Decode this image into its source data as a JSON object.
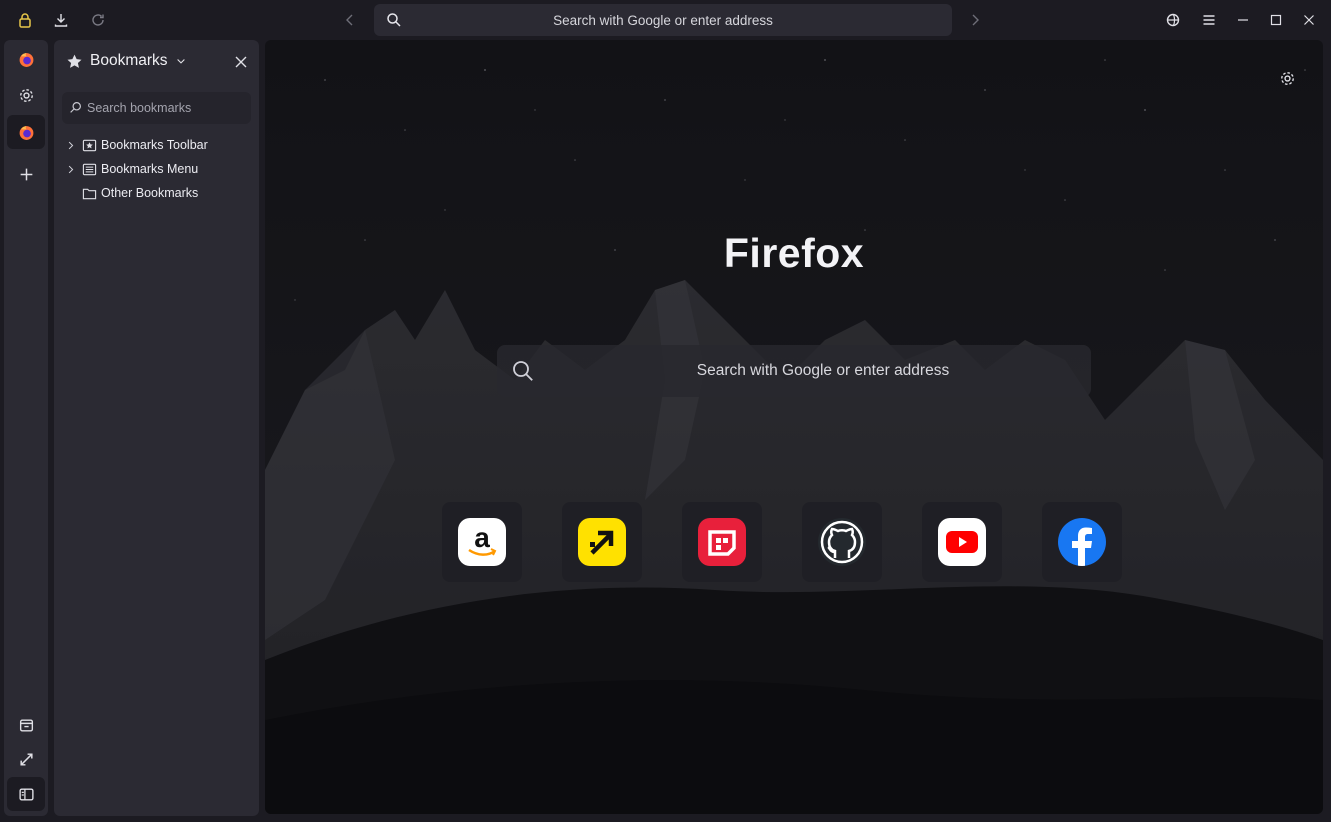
{
  "toolbar": {
    "url_placeholder": "Search with Google or enter address",
    "icons": [
      "lock-icon",
      "download-icon",
      "reload-icon",
      "back-icon",
      "search-icon",
      "forward-icon",
      "account-icon",
      "menu-icon",
      "minimize-icon",
      "maximize-icon",
      "close-icon"
    ]
  },
  "sidebar_strip": {
    "top_icons": [
      "firefox-icon",
      "settings-icon",
      "firefox-active-icon",
      "add-icon"
    ],
    "bottom_icons": [
      "archive-icon",
      "expand-icon",
      "sidebar-toggle-icon"
    ]
  },
  "bookmarks_panel": {
    "title": "Bookmarks",
    "search_placeholder": "Search bookmarks",
    "items": [
      {
        "label": "Bookmarks Toolbar",
        "expandable": true
      },
      {
        "label": "Bookmarks Menu",
        "expandable": true
      },
      {
        "label": "Other Bookmarks",
        "expandable": false
      }
    ]
  },
  "newtab": {
    "brand": "Firefox",
    "search_placeholder": "Search with Google or enter address",
    "shortcuts": [
      {
        "site": "amazon",
        "color": "#ffffff"
      },
      {
        "site": "tripadvisor-arrow",
        "color": "#ffe100"
      },
      {
        "site": "flipboard-style",
        "color": "#e8203b"
      },
      {
        "site": "github",
        "color": "#24292e"
      },
      {
        "site": "youtube",
        "color": "#ffffff"
      },
      {
        "site": "facebook",
        "color": "#1877f2"
      }
    ]
  },
  "colors": {
    "window_bg": "#1c1b22",
    "panel_bg": "#2b2a33"
  }
}
